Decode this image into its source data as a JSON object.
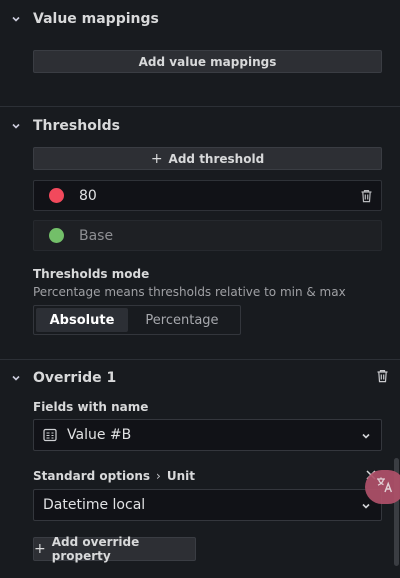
{
  "value_mappings": {
    "title": "Value mappings",
    "add_button": "Add value mappings"
  },
  "thresholds": {
    "title": "Thresholds",
    "add_button": "Add threshold",
    "rows": [
      {
        "value": "80",
        "color": "#f2495c"
      },
      {
        "value": "Base",
        "color": "#73bf69"
      }
    ],
    "mode_label": "Thresholds mode",
    "mode_description": "Percentage means thresholds relative to min & max",
    "mode_options": [
      "Absolute",
      "Percentage"
    ],
    "mode_selected": "Absolute"
  },
  "override": {
    "title": "Override 1",
    "fields_label": "Fields with name",
    "field_value": "Value #B",
    "property_path": [
      "Standard options",
      "Unit"
    ],
    "unit_value": "Datetime local",
    "add_property_button": "Add override property"
  },
  "icons": {
    "collapse": "chevron-down-icon",
    "trash": "trash-icon",
    "field": "field-name-icon",
    "translate": "translate-icon"
  }
}
